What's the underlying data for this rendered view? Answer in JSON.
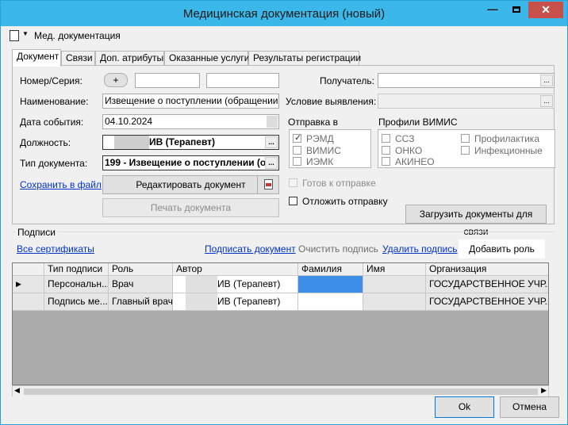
{
  "window": {
    "title": "Медицинская документация (новый)",
    "close": "✕",
    "minimize": "—"
  },
  "toolbar": {
    "label": "Мед. документация"
  },
  "tabs": [
    "Документ",
    "Связи",
    "Доп. атрибуты",
    "Оказанные услуги",
    "Результаты регистрации"
  ],
  "form": {
    "number_label": "Номер/Серия:",
    "plus": "+",
    "name_label": "Наименование:",
    "name_value": "Извещение о поступлении (обращении) пац",
    "date_label": "Дата события:",
    "date_value": "04.10.2024",
    "position_label": "Должность:",
    "position_value": "ИВ (Терапевт)",
    "doctype_label": "Тип документа:",
    "doctype_value": "199 - Извещение о поступлении (о",
    "recipient_label": "Получатель:",
    "detection_label": "Условие выявления:",
    "save_link": "Сохранить в файл",
    "edit_button": "Редактировать документ",
    "print_button": "Печать документа",
    "dots": "..."
  },
  "send": {
    "label": "Отправка в",
    "items": [
      {
        "label": "РЭМД",
        "checked": true
      },
      {
        "label": "ВИМИС",
        "checked": false
      },
      {
        "label": "ИЭМК",
        "checked": false
      }
    ]
  },
  "vimis": {
    "label": "Профили ВИМИС",
    "col1": [
      "ССЗ",
      "ОНКО",
      "АКИНЕО"
    ],
    "col2": [
      "Профилактика",
      "Инфекционные"
    ]
  },
  "ready_label": "Готов к отправке",
  "postpone_label": "Отложить отправку",
  "upload_button": "Загрузить документы для связи",
  "signatures": {
    "group_label": "Подписи",
    "all_certs": "Все сертификаты",
    "sign_doc": "Подписать документ",
    "clear": "Очистить подпись",
    "delete": "Удалить подпись",
    "add_role": "Добавить роль",
    "columns": [
      "Тип подписи",
      "Роль",
      "Автор",
      "Фамилия",
      "Имя",
      "Организация"
    ],
    "rows": [
      {
        "marker": "▶",
        "type": "Персональн...",
        "role": "Врач",
        "author": "ИВ (Терапевт)",
        "surname": "",
        "name": "",
        "org": "ГОСУДАРСТВЕННОЕ УЧР..."
      },
      {
        "marker": "",
        "type": "Подпись ме...",
        "role": "Главный врач",
        "author": "ИВ (Терапевт)",
        "surname": "",
        "name": "",
        "org": "ГОСУДАРСТВЕННОЕ УЧР..."
      }
    ]
  },
  "footer": {
    "ok": "Ok",
    "cancel": "Отмена"
  }
}
